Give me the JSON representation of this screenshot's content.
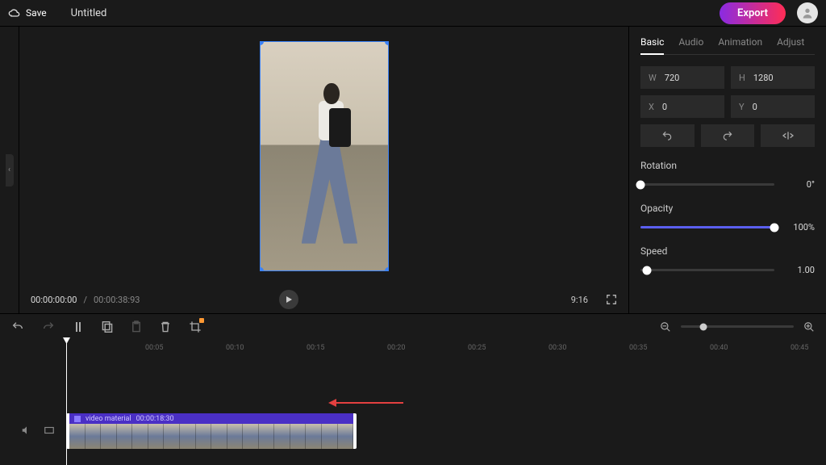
{
  "header": {
    "save_label": "Save",
    "title": "Untitled",
    "export_label": "Export"
  },
  "preview": {
    "current_time": "00:00:00:00",
    "total_time": "00:00:38:93",
    "aspect": "9:16"
  },
  "inspector": {
    "tabs": {
      "basic": "Basic",
      "audio": "Audio",
      "animation": "Animation",
      "adjust": "Adjust"
    },
    "width_label": "W",
    "width_value": "720",
    "height_label": "H",
    "height_value": "1280",
    "x_label": "X",
    "x_value": "0",
    "y_label": "Y",
    "y_value": "0",
    "rotation_label": "Rotation",
    "rotation_value": "0°",
    "opacity_label": "Opacity",
    "opacity_value": "100%",
    "speed_label": "Speed",
    "speed_value": "1.00"
  },
  "timeline": {
    "ruler": [
      "00:05",
      "00:10",
      "00:15",
      "00:20",
      "00:25",
      "00:30",
      "00:35",
      "00:40",
      "00:45"
    ],
    "clip_name": "video material",
    "clip_duration": "00:00:18:30"
  }
}
